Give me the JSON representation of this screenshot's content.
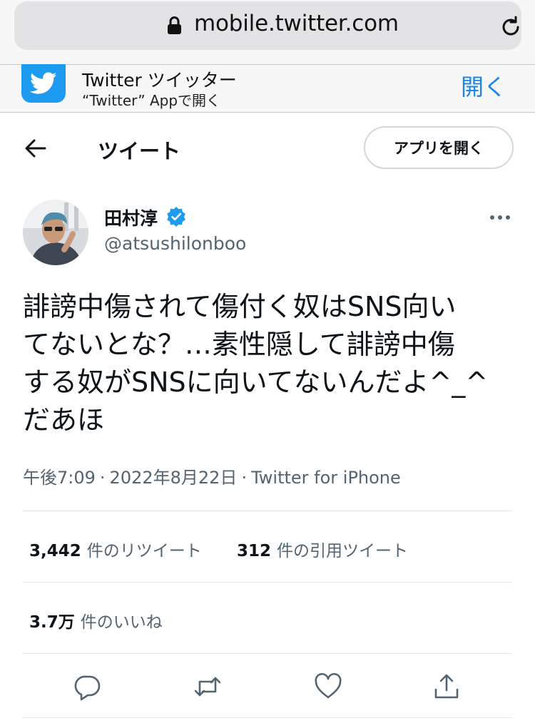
{
  "browser": {
    "url": "mobile.twitter.com"
  },
  "banner": {
    "title": "Twitter ツイッター",
    "subtitle": "“Twitter” Appで開く",
    "open_label": "開く"
  },
  "header": {
    "title": "ツイート",
    "open_app_label": "アプリを開く"
  },
  "author": {
    "name": "田村淳",
    "handle": "@atsushilonboo"
  },
  "tweet": {
    "text": "誹謗中傷されて傷付く奴はSNS向い\nてないとな？…素性隠して誹謗中傷\nする奴がSNSに向いてないんだよ^_^\nだあほ",
    "time": "午後7:09",
    "date": "2022年8月22日",
    "source": "Twitter for iPhone"
  },
  "stats": {
    "retweets_count": "3,442",
    "retweets_label": "件のリツイート",
    "quotes_count": "312",
    "quotes_label": "件の引用ツイート",
    "likes_count": "3.7万",
    "likes_label": "件のいいね"
  },
  "colors": {
    "twitter_blue": "#1d9bf0",
    "link_blue": "#1a84e8",
    "secondary_text": "#536471"
  }
}
